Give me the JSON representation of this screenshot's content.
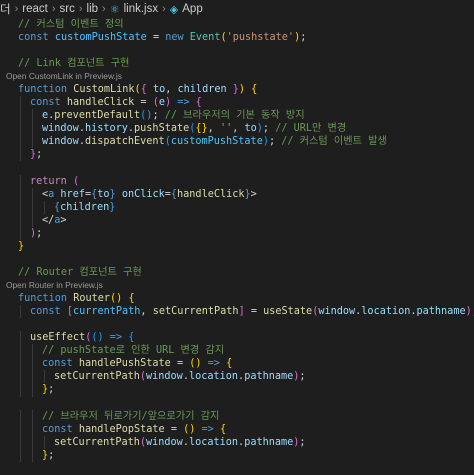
{
  "breadcrumb": {
    "lead": "더",
    "items": [
      "react",
      "src",
      "lib",
      "link.jsx",
      "App"
    ]
  },
  "colors": {
    "background": "#1e1e1e",
    "keyword": "#569cd6",
    "control": "#c586c0",
    "function": "#dcdcaa",
    "variable": "#9cdcfe",
    "constant": "#4fc1ff",
    "string": "#ce9178",
    "comment": "#6a9955",
    "bracket_1": "#ffd700",
    "bracket_2": "#da70d6",
    "bracket_3": "#179fff"
  },
  "code": {
    "lines": [
      {
        "kind": "code",
        "indent": 1,
        "tokens": [
          [
            "cm",
            "// 커스텀 이벤트 정의"
          ]
        ]
      },
      {
        "kind": "code",
        "indent": 1,
        "tokens": [
          [
            "kw",
            "const "
          ],
          [
            "cn",
            "customPushState"
          ],
          [
            "op",
            " = "
          ],
          [
            "kw",
            "new "
          ],
          [
            "ty",
            "Event"
          ],
          [
            "b1",
            "("
          ],
          [
            "st",
            "'pushstate'"
          ],
          [
            "b1",
            ")"
          ],
          [
            "op",
            ";"
          ]
        ]
      },
      {
        "kind": "blank"
      },
      {
        "kind": "code",
        "indent": 1,
        "tokens": [
          [
            "cm",
            "// Link 컴포넌트 구현"
          ]
        ]
      },
      {
        "kind": "lens",
        "indent": 1,
        "text": "Open CustomLink in Preview.js"
      },
      {
        "kind": "code",
        "indent": 1,
        "tokens": [
          [
            "kw",
            "function "
          ],
          [
            "fn",
            "CustomLink"
          ],
          [
            "b1",
            "("
          ],
          [
            "b2",
            "{ "
          ],
          [
            "vr",
            "to"
          ],
          [
            "op",
            ", "
          ],
          [
            "vr",
            "children"
          ],
          [
            "b2",
            " }"
          ],
          [
            "b1",
            ")"
          ],
          [
            "op",
            " "
          ],
          [
            "b1",
            "{"
          ]
        ]
      },
      {
        "kind": "code",
        "indent": 2,
        "tokens": [
          [
            "kw",
            "const "
          ],
          [
            "fn",
            "handleClick"
          ],
          [
            "op",
            " = "
          ],
          [
            "b2",
            "("
          ],
          [
            "vr",
            "e"
          ],
          [
            "b2",
            ")"
          ],
          [
            "op",
            " "
          ],
          [
            "kw",
            "=>"
          ],
          [
            "op",
            " "
          ],
          [
            "b2",
            "{"
          ]
        ]
      },
      {
        "kind": "code",
        "indent": 3,
        "tokens": [
          [
            "vr",
            "e"
          ],
          [
            "op",
            "."
          ],
          [
            "fn",
            "preventDefault"
          ],
          [
            "b3",
            "()"
          ],
          [
            "op",
            "; "
          ],
          [
            "cm",
            "// 브라우저의 기본 동작 방지"
          ]
        ]
      },
      {
        "kind": "code",
        "indent": 3,
        "tokens": [
          [
            "vr",
            "window"
          ],
          [
            "op",
            "."
          ],
          [
            "vr",
            "history"
          ],
          [
            "op",
            "."
          ],
          [
            "fn",
            "pushState"
          ],
          [
            "b3",
            "("
          ],
          [
            "b1",
            "{}"
          ],
          [
            "op",
            ", "
          ],
          [
            "st",
            "''"
          ],
          [
            "op",
            ", "
          ],
          [
            "vr",
            "to"
          ],
          [
            "b3",
            ")"
          ],
          [
            "op",
            "; "
          ],
          [
            "cm",
            "// URL만 변경"
          ]
        ]
      },
      {
        "kind": "code",
        "indent": 3,
        "tokens": [
          [
            "vr",
            "window"
          ],
          [
            "op",
            "."
          ],
          [
            "fn",
            "dispatchEvent"
          ],
          [
            "b3",
            "("
          ],
          [
            "cn",
            "customPushState"
          ],
          [
            "b3",
            ")"
          ],
          [
            "op",
            "; "
          ],
          [
            "cm",
            "// 커스텀 이벤트 발생"
          ]
        ]
      },
      {
        "kind": "code",
        "indent": 2,
        "tokens": [
          [
            "b2",
            "}"
          ],
          [
            "op",
            ";"
          ]
        ]
      },
      {
        "kind": "blank"
      },
      {
        "kind": "code",
        "indent": 2,
        "tokens": [
          [
            "cf",
            "return "
          ],
          [
            "b2",
            "("
          ]
        ]
      },
      {
        "kind": "code",
        "indent": 3,
        "tokens": [
          [
            "op",
            "<"
          ],
          [
            "tg",
            "a "
          ],
          [
            "vr",
            "href"
          ],
          [
            "op",
            "="
          ],
          [
            "kw",
            "{"
          ],
          [
            "vr",
            "to"
          ],
          [
            "kw",
            "}"
          ],
          [
            "op",
            " "
          ],
          [
            "vr",
            "onClick"
          ],
          [
            "op",
            "="
          ],
          [
            "kw",
            "{"
          ],
          [
            "fn",
            "handleClick"
          ],
          [
            "kw",
            "}"
          ],
          [
            "op",
            ">"
          ]
        ]
      },
      {
        "kind": "code",
        "indent": 4,
        "tokens": [
          [
            "kw",
            "{"
          ],
          [
            "vr",
            "children"
          ],
          [
            "kw",
            "}"
          ]
        ]
      },
      {
        "kind": "code",
        "indent": 3,
        "tokens": [
          [
            "op",
            "</"
          ],
          [
            "tg",
            "a"
          ],
          [
            "op",
            ">"
          ]
        ]
      },
      {
        "kind": "code",
        "indent": 2,
        "tokens": [
          [
            "b2",
            ")"
          ],
          [
            "op",
            ";"
          ]
        ]
      },
      {
        "kind": "code",
        "indent": 1,
        "tokens": [
          [
            "b1",
            "}"
          ]
        ]
      },
      {
        "kind": "blank"
      },
      {
        "kind": "code",
        "indent": 1,
        "tokens": [
          [
            "cm",
            "// Router 컴포넌트 구현"
          ]
        ]
      },
      {
        "kind": "lens",
        "indent": 1,
        "text": "Open Router in Preview.js"
      },
      {
        "kind": "code",
        "indent": 1,
        "tokens": [
          [
            "kw",
            "function "
          ],
          [
            "fn",
            "Router"
          ],
          [
            "b1",
            "()"
          ],
          [
            "op",
            " "
          ],
          [
            "b1",
            "{"
          ]
        ]
      },
      {
        "kind": "code",
        "indent": 2,
        "tokens": [
          [
            "kw",
            "const "
          ],
          [
            "b2",
            "["
          ],
          [
            "cn",
            "currentPath"
          ],
          [
            "op",
            ", "
          ],
          [
            "fn",
            "setCurrentPath"
          ],
          [
            "b2",
            "]"
          ],
          [
            "op",
            " = "
          ],
          [
            "fn",
            "useState"
          ],
          [
            "b2",
            "("
          ],
          [
            "vr",
            "window"
          ],
          [
            "op",
            "."
          ],
          [
            "vr",
            "location"
          ],
          [
            "op",
            "."
          ],
          [
            "vr",
            "pathname"
          ],
          [
            "b2",
            ")"
          ],
          [
            "op",
            ";"
          ]
        ]
      },
      {
        "kind": "blank"
      },
      {
        "kind": "code",
        "indent": 2,
        "tokens": [
          [
            "fn",
            "useEffect"
          ],
          [
            "b2",
            "("
          ],
          [
            "b3",
            "()"
          ],
          [
            "op",
            " "
          ],
          [
            "kw",
            "=>"
          ],
          [
            "op",
            " "
          ],
          [
            "b3",
            "{"
          ]
        ]
      },
      {
        "kind": "code",
        "indent": 3,
        "tokens": [
          [
            "cm",
            "// pushState로 인한 URL 변경 감지"
          ]
        ]
      },
      {
        "kind": "code",
        "indent": 3,
        "tokens": [
          [
            "kw",
            "const "
          ],
          [
            "fn",
            "handlePushState"
          ],
          [
            "op",
            " = "
          ],
          [
            "b1",
            "()"
          ],
          [
            "op",
            " "
          ],
          [
            "kw",
            "=>"
          ],
          [
            "op",
            " "
          ],
          [
            "b1",
            "{"
          ]
        ]
      },
      {
        "kind": "code",
        "indent": 4,
        "tokens": [
          [
            "fn",
            "setCurrentPath"
          ],
          [
            "b2",
            "("
          ],
          [
            "vr",
            "window"
          ],
          [
            "op",
            "."
          ],
          [
            "vr",
            "location"
          ],
          [
            "op",
            "."
          ],
          [
            "vr",
            "pathname"
          ],
          [
            "b2",
            ")"
          ],
          [
            "op",
            ";"
          ]
        ]
      },
      {
        "kind": "code",
        "indent": 3,
        "tokens": [
          [
            "b1",
            "}"
          ],
          [
            "op",
            ";"
          ]
        ]
      },
      {
        "kind": "blank"
      },
      {
        "kind": "code",
        "indent": 3,
        "tokens": [
          [
            "cm",
            "// 브라우저 뒤로가기/앞으로가기 감지"
          ]
        ]
      },
      {
        "kind": "code",
        "indent": 3,
        "tokens": [
          [
            "kw",
            "const "
          ],
          [
            "fn",
            "handlePopState"
          ],
          [
            "op",
            " = "
          ],
          [
            "b1",
            "()"
          ],
          [
            "op",
            " "
          ],
          [
            "kw",
            "=>"
          ],
          [
            "op",
            " "
          ],
          [
            "b1",
            "{"
          ]
        ]
      },
      {
        "kind": "code",
        "indent": 4,
        "tokens": [
          [
            "fn",
            "setCurrentPath"
          ],
          [
            "b2",
            "("
          ],
          [
            "vr",
            "window"
          ],
          [
            "op",
            "."
          ],
          [
            "vr",
            "location"
          ],
          [
            "op",
            "."
          ],
          [
            "vr",
            "pathname"
          ],
          [
            "b2",
            ")"
          ],
          [
            "op",
            ";"
          ]
        ]
      },
      {
        "kind": "code",
        "indent": 3,
        "tokens": [
          [
            "b1",
            "}"
          ],
          [
            "op",
            ";"
          ]
        ]
      }
    ]
  }
}
